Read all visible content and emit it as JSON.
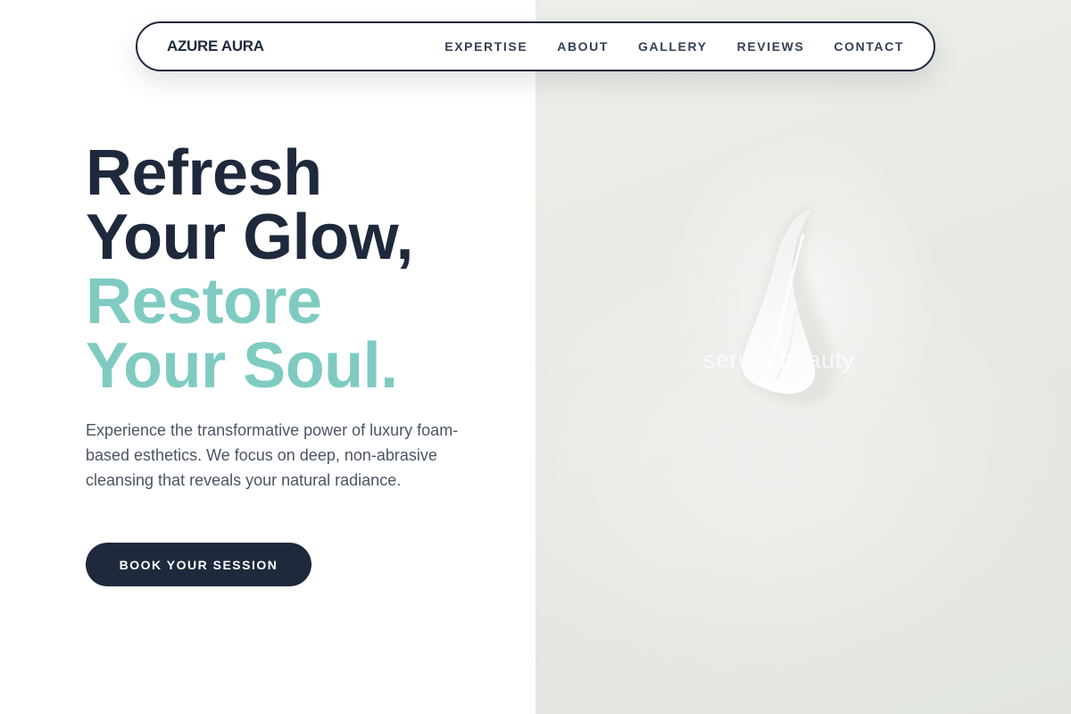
{
  "brand": {
    "name": "AZURE AURA"
  },
  "nav": {
    "items": [
      {
        "label": "EXPERTISE"
      },
      {
        "label": "ABOUT"
      },
      {
        "label": "GALLERY"
      },
      {
        "label": "REVIEWS"
      },
      {
        "label": "CONTACT"
      }
    ]
  },
  "hero": {
    "title_lines": [
      {
        "text": "Refresh",
        "style": "dark"
      },
      {
        "text": "Your Glow,",
        "style": "dark"
      },
      {
        "text": "Restore",
        "style": "accent"
      },
      {
        "text": "Your Soul.",
        "style": "accent"
      }
    ],
    "description": "Experience the transformative power of luxury foam-based esthetics. We focus on deep, non-abrasive cleansing that reveals your natural radiance.",
    "cta_label": "BOOK YOUR SESSION",
    "image": {
      "watermark_text": "serum beauty",
      "icon": "foam-swatch-image"
    }
  },
  "colors": {
    "primary_dark": "#1e293b",
    "accent_teal": "#7fcbc1",
    "body_text": "#4b5563",
    "image_background": "#e7e9e4"
  }
}
